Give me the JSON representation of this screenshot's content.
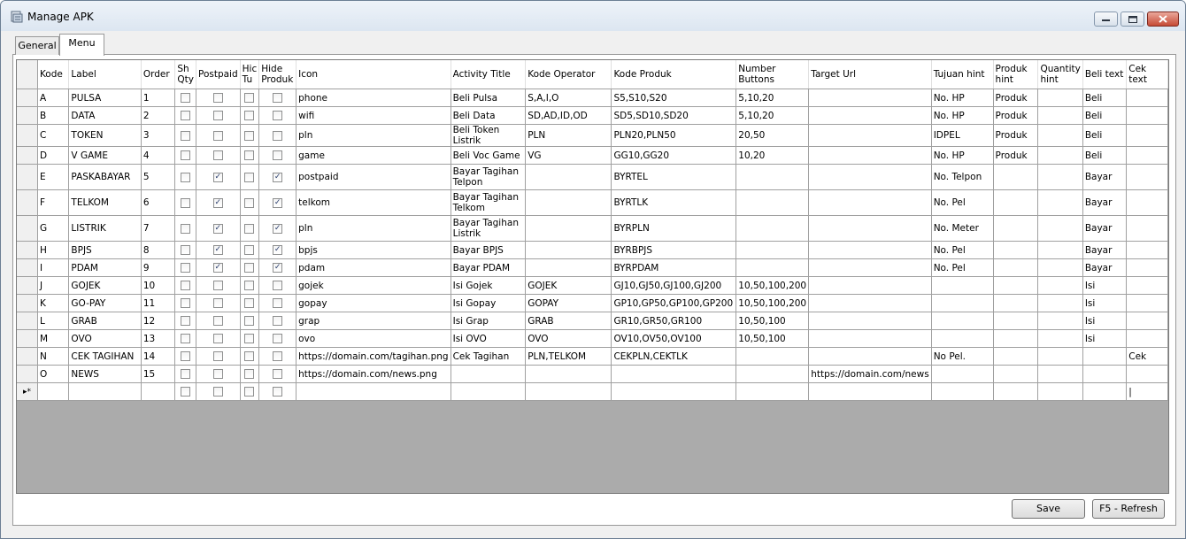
{
  "window": {
    "title": "Manage APK"
  },
  "tabs": [
    {
      "label": "General"
    },
    {
      "label": "Menu"
    }
  ],
  "grid": {
    "columns": [
      "Kode",
      "Label",
      "Order",
      "Sh Qty",
      "Postpaid",
      "Hic Tu",
      "Hide Produk",
      "Icon",
      "Activity Title",
      "Kode Operator",
      "Kode Produk",
      "Number Buttons",
      "Target Url",
      "Tujuan hint",
      "Produk hint",
      "Quantity hint",
      "Beli text",
      "Cek text"
    ],
    "rows": [
      {
        "kode": "A",
        "label": "PULSA",
        "order": "1",
        "shqty": false,
        "postpaid": false,
        "hidetu": false,
        "hideproduk": false,
        "icon": "phone",
        "activity": "Beli Pulsa",
        "operator": "S,A,I,O",
        "produk": "S5,S10,S20",
        "numbers": "5,10,20",
        "target": "",
        "tujuan": "No. HP",
        "produkhint": "Produk",
        "qty": "",
        "beli": "Beli",
        "cek": ""
      },
      {
        "kode": "B",
        "label": "DATA",
        "order": "2",
        "shqty": false,
        "postpaid": false,
        "hidetu": false,
        "hideproduk": false,
        "icon": "wifi",
        "activity": "Beli Data",
        "operator": "SD,AD,ID,OD",
        "produk": "SD5,SD10,SD20",
        "numbers": "5,10,20",
        "target": "",
        "tujuan": "No. HP",
        "produkhint": "Produk",
        "qty": "",
        "beli": "Beli",
        "cek": ""
      },
      {
        "kode": "C",
        "label": "TOKEN",
        "order": "3",
        "shqty": false,
        "postpaid": false,
        "hidetu": false,
        "hideproduk": false,
        "icon": "pln",
        "activity": "Beli Token Listrik",
        "operator": "PLN",
        "produk": "PLN20,PLN50",
        "numbers": "20,50",
        "target": "",
        "tujuan": "IDPEL",
        "produkhint": "Produk",
        "qty": "",
        "beli": "Beli",
        "cek": ""
      },
      {
        "kode": "D",
        "label": "V GAME",
        "order": "4",
        "shqty": false,
        "postpaid": false,
        "hidetu": false,
        "hideproduk": false,
        "icon": "game",
        "activity": "Beli Voc Game",
        "operator": "VG",
        "produk": "GG10,GG20",
        "numbers": "10,20",
        "target": "",
        "tujuan": "No. HP",
        "produkhint": "Produk",
        "qty": "",
        "beli": "Beli",
        "cek": ""
      },
      {
        "kode": "E",
        "label": "PASKABAYAR",
        "order": "5",
        "shqty": false,
        "postpaid": true,
        "hidetu": false,
        "hideproduk": true,
        "icon": "postpaid",
        "activity": "Bayar Tagihan Telpon",
        "operator": "",
        "produk": "BYRTEL",
        "numbers": "",
        "target": "",
        "tujuan": "No. Telpon",
        "produkhint": "",
        "qty": "",
        "beli": "Bayar",
        "cek": ""
      },
      {
        "kode": "F",
        "label": "TELKOM",
        "order": "6",
        "shqty": false,
        "postpaid": true,
        "hidetu": false,
        "hideproduk": true,
        "icon": "telkom",
        "activity": "Bayar Tagihan Telkom",
        "operator": "",
        "produk": "BYRTLK",
        "numbers": "",
        "target": "",
        "tujuan": "No. Pel",
        "produkhint": "",
        "qty": "",
        "beli": "Bayar",
        "cek": ""
      },
      {
        "kode": "G",
        "label": "LISTRIK",
        "order": "7",
        "shqty": false,
        "postpaid": true,
        "hidetu": false,
        "hideproduk": true,
        "icon": "pln",
        "activity": "Bayar Tagihan Listrik",
        "operator": "",
        "produk": "BYRPLN",
        "numbers": "",
        "target": "",
        "tujuan": "No. Meter",
        "produkhint": "",
        "qty": "",
        "beli": "Bayar",
        "cek": ""
      },
      {
        "kode": "H",
        "label": "BPJS",
        "order": "8",
        "shqty": false,
        "postpaid": true,
        "hidetu": false,
        "hideproduk": true,
        "icon": "bpjs",
        "activity": "Bayar BPJS",
        "operator": "",
        "produk": "BYRBPJS",
        "numbers": "",
        "target": "",
        "tujuan": "No. Pel",
        "produkhint": "",
        "qty": "",
        "beli": "Bayar",
        "cek": ""
      },
      {
        "kode": "I",
        "label": "PDAM",
        "order": "9",
        "shqty": false,
        "postpaid": true,
        "hidetu": false,
        "hideproduk": true,
        "icon": "pdam",
        "activity": "Bayar PDAM",
        "operator": "",
        "produk": "BYRPDAM",
        "numbers": "",
        "target": "",
        "tujuan": "No. Pel",
        "produkhint": "",
        "qty": "",
        "beli": "Bayar",
        "cek": ""
      },
      {
        "kode": "J",
        "label": "GOJEK",
        "order": "10",
        "shqty": false,
        "postpaid": false,
        "hidetu": false,
        "hideproduk": false,
        "icon": "gojek",
        "activity": "Isi Gojek",
        "operator": "GOJEK",
        "produk": "GJ10,GJ50,GJ100,GJ200",
        "numbers": "10,50,100,200",
        "target": "",
        "tujuan": "",
        "produkhint": "",
        "qty": "",
        "beli": "Isi",
        "cek": ""
      },
      {
        "kode": "K",
        "label": "GO-PAY",
        "order": "11",
        "shqty": false,
        "postpaid": false,
        "hidetu": false,
        "hideproduk": false,
        "icon": "gopay",
        "activity": "Isi Gopay",
        "operator": "GOPAY",
        "produk": "GP10,GP50,GP100,GP200",
        "numbers": "10,50,100,200",
        "target": "",
        "tujuan": "",
        "produkhint": "",
        "qty": "",
        "beli": "Isi",
        "cek": ""
      },
      {
        "kode": "L",
        "label": "GRAB",
        "order": "12",
        "shqty": false,
        "postpaid": false,
        "hidetu": false,
        "hideproduk": false,
        "icon": "grap",
        "activity": "Isi Grap",
        "operator": "GRAB",
        "produk": "GR10,GR50,GR100",
        "numbers": "10,50,100",
        "target": "",
        "tujuan": "",
        "produkhint": "",
        "qty": "",
        "beli": "Isi",
        "cek": ""
      },
      {
        "kode": "M",
        "label": "OVO",
        "order": "13",
        "shqty": false,
        "postpaid": false,
        "hidetu": false,
        "hideproduk": false,
        "icon": "ovo",
        "activity": "Isi OVO",
        "operator": "OVO",
        "produk": "OV10,OV50,OV100",
        "numbers": "10,50,100",
        "target": "",
        "tujuan": "",
        "produkhint": "",
        "qty": "",
        "beli": "Isi",
        "cek": ""
      },
      {
        "kode": "N",
        "label": "CEK TAGIHAN",
        "order": "14",
        "shqty": false,
        "postpaid": false,
        "hidetu": false,
        "hideproduk": false,
        "icon": "https://domain.com/tagihan.png",
        "activity": "Cek Tagihan",
        "operator": "PLN,TELKOM",
        "produk": "CEKPLN,CEKTLK",
        "numbers": "",
        "target": "",
        "tujuan": "No Pel.",
        "produkhint": "",
        "qty": "",
        "beli": "",
        "cek": "Cek"
      },
      {
        "kode": "O",
        "label": "NEWS",
        "order": "15",
        "shqty": false,
        "postpaid": false,
        "hidetu": false,
        "hideproduk": false,
        "icon": "https://domain.com/news.png",
        "activity": "",
        "operator": "",
        "produk": "",
        "numbers": "",
        "target": "https://domain.com/news",
        "tujuan": "",
        "produkhint": "",
        "qty": "",
        "beli": "",
        "cek": ""
      }
    ],
    "new_row_marker": "▸*",
    "new_row_cursor": "|"
  },
  "buttons": {
    "save": "Save",
    "refresh": "F5 - Refresh"
  },
  "icons": {
    "app": "apk-window-icon",
    "minimize": "minimize-icon",
    "maximize": "maximize-icon",
    "close": "close-icon"
  },
  "colors": {
    "title_bg": "#dce6f1",
    "close_button": "#c64a35",
    "grid_border": "#a0a0a0",
    "grid_empty": "#ababab"
  }
}
